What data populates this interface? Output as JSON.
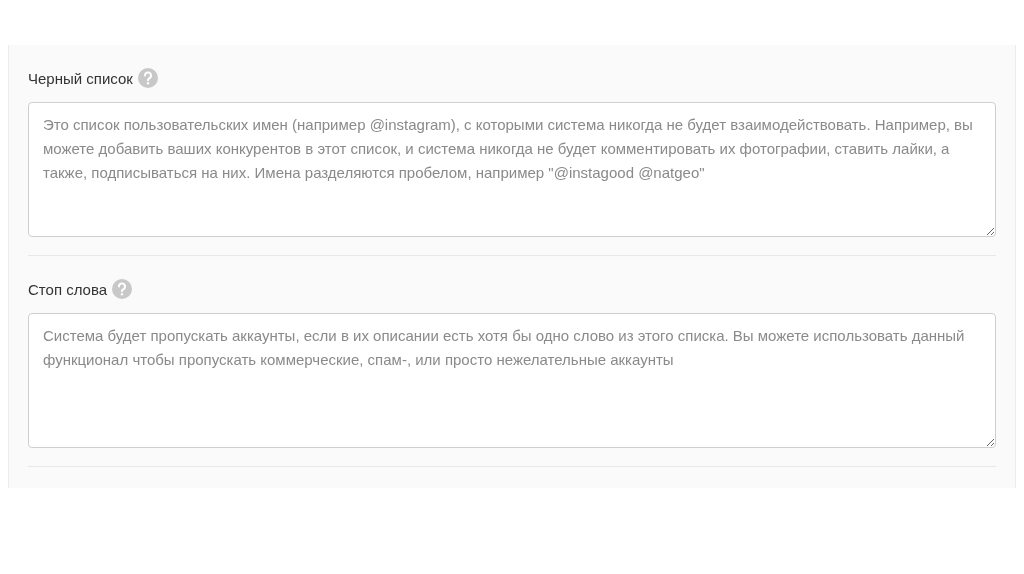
{
  "fields": [
    {
      "label": "Черный список",
      "placeholder": "Это список пользовательских имен (например @instagram), с которыми система никогда не будет взаимодействовать. Например, вы можете добавить ваших конкурентов в этот список, и система никогда не будет комментировать их фотографии, ставить лайки, а также, подписываться на них. Имена разделяются пробелом, например \"@instagood @natgeo\""
    },
    {
      "label": "Стоп слова",
      "placeholder": "Система будет пропускать аккаунты, если в их описании есть хотя бы одно слово из этого списка. Вы можете использовать данный функционал чтобы пропускать коммерческие, спам-, или просто нежелательные аккаунты"
    }
  ]
}
